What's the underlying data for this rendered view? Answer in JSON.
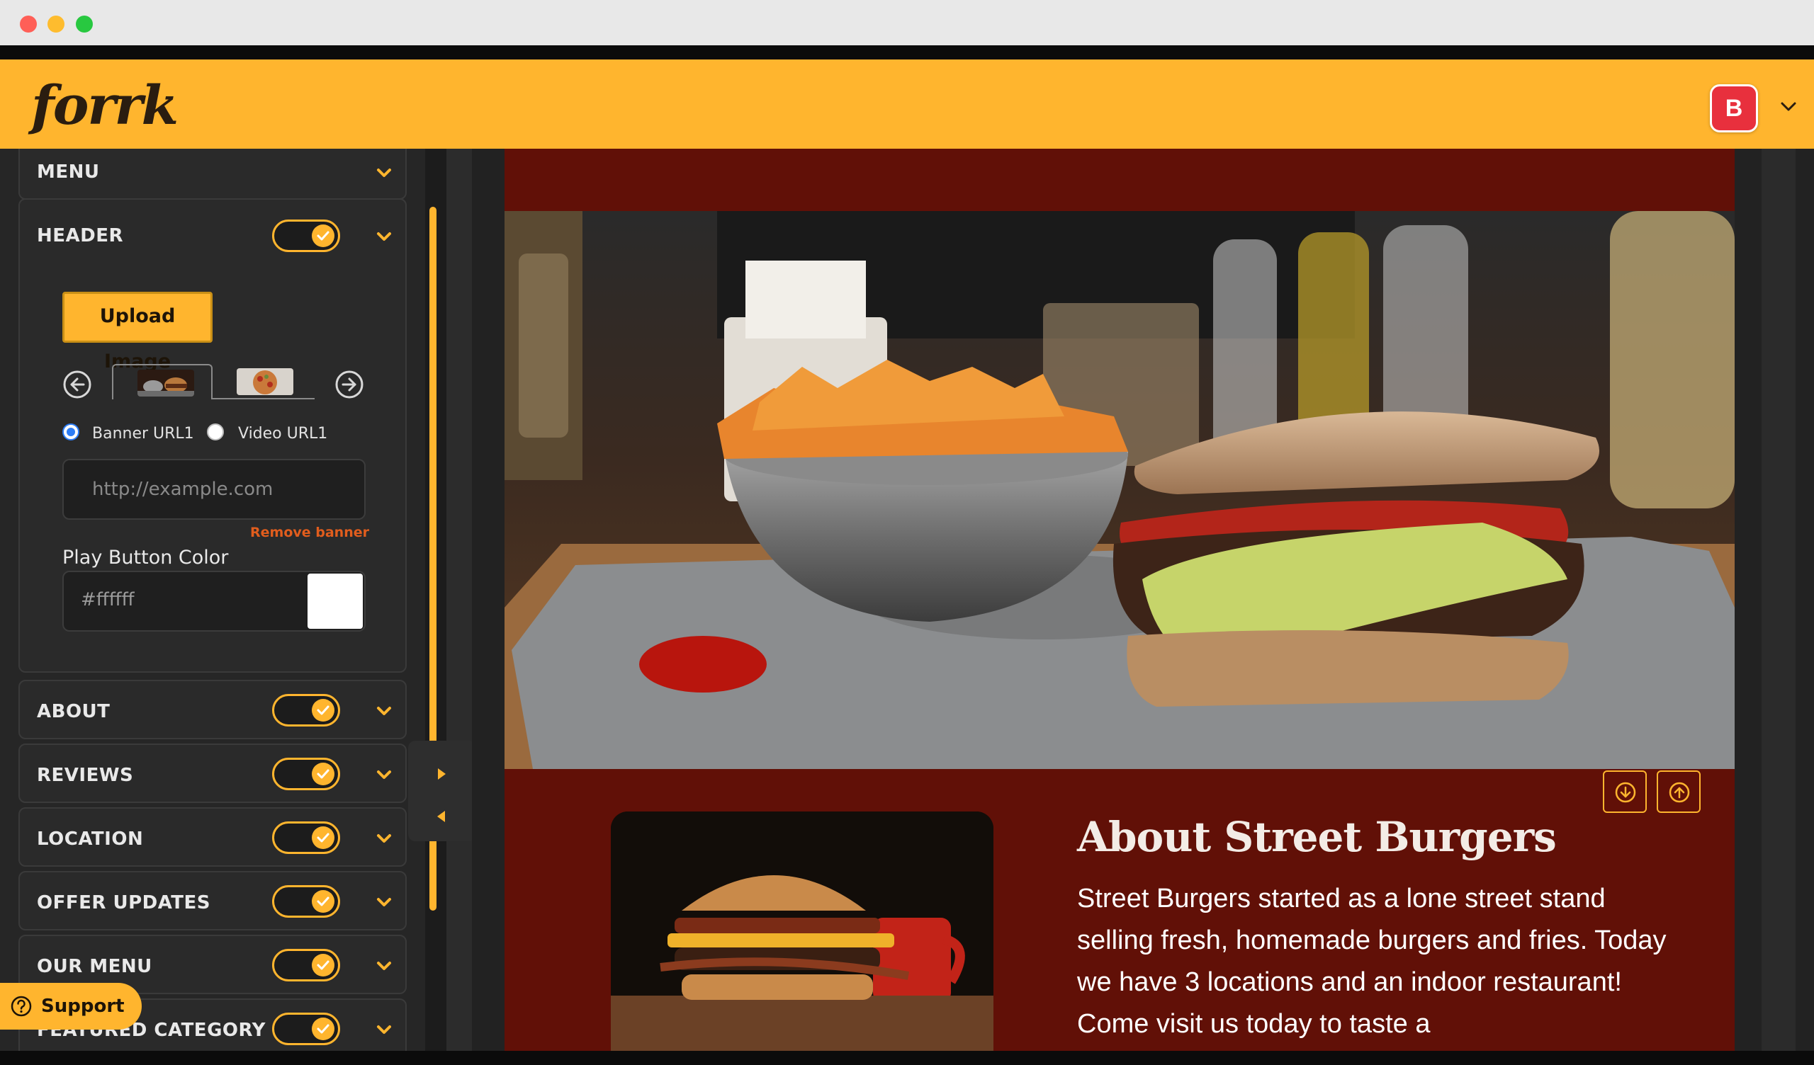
{
  "app": {
    "logo_text": "forrk",
    "account_initial": "B",
    "brand_color": "#ffb52e",
    "site_color": "#611007"
  },
  "sidebar": {
    "menu_title": "MENU",
    "header_section": {
      "title": "HEADER",
      "enabled": true,
      "upload_button": "Upload Image",
      "radio_banner_label": "Banner URL1",
      "radio_video_label": "Video URL1",
      "selected_radio": "Banner URL1",
      "url_placeholder": "http://example.com",
      "url_value": "",
      "remove_banner": "Remove banner",
      "play_button_color_label": "Play Button Color",
      "play_button_color_value": "#ffffff"
    },
    "sections": [
      {
        "title": "ABOUT",
        "enabled": true
      },
      {
        "title": "REVIEWS",
        "enabled": true
      },
      {
        "title": "LOCATION",
        "enabled": true
      },
      {
        "title": "OFFER UPDATES",
        "enabled": true
      },
      {
        "title": "OUR MENU",
        "enabled": true
      },
      {
        "title": "FEATURED CATEGORY",
        "enabled": true
      }
    ],
    "support_label": "Support"
  },
  "preview": {
    "about_title": "About Street Burgers",
    "about_text": "Street Burgers started as a lone street stand selling fresh, homemade burgers and fries. Today we have 3 locations and an indoor restaurant! Come visit us today to taste a"
  }
}
